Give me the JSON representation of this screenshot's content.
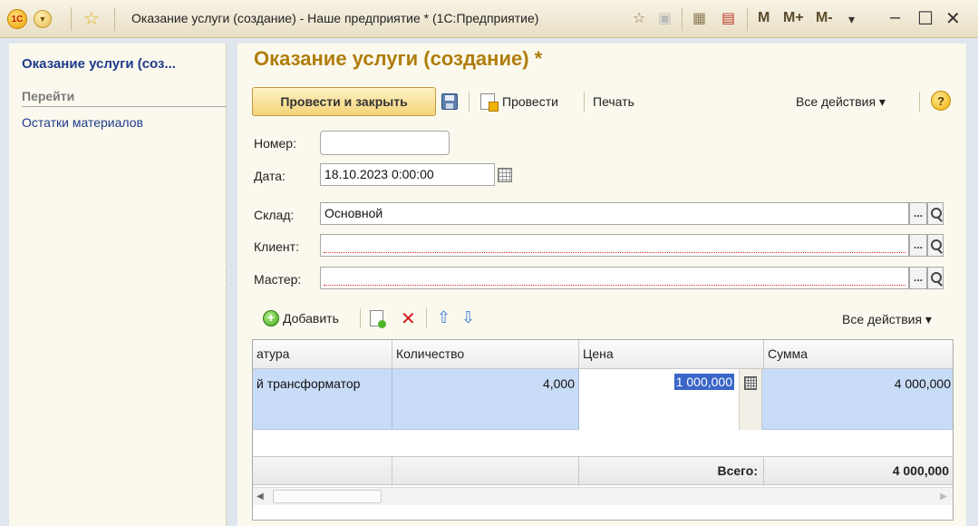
{
  "window": {
    "title": "Оказание услуги (создание) - Наше предприятие * (1С:Предприятие)",
    "logo_text": "1С",
    "controls": {
      "m": "M",
      "m_plus": "M+",
      "m_minus": "M-"
    }
  },
  "sidebar": {
    "title": "Оказание услуги (соз...",
    "section": "Перейти",
    "links": [
      "Остатки материалов"
    ]
  },
  "form": {
    "title": "Оказание услуги (создание) *",
    "toolbar": {
      "post_and_close": "Провести и закрыть",
      "post": "Провести",
      "print": "Печать",
      "all_actions": "Все действия ▾",
      "help": "?"
    },
    "fields": {
      "number": {
        "label": "Номер:",
        "value": ""
      },
      "date": {
        "label": "Дата:",
        "value": "18.10.2023  0:00:00"
      },
      "warehouse": {
        "label": "Склад:",
        "value": "Основной"
      },
      "client": {
        "label": "Клиент:",
        "value": ""
      },
      "master": {
        "label": "Мастер:",
        "value": ""
      }
    },
    "table_toolbar": {
      "add": "Добавить",
      "all_actions": "Все действия ▾"
    },
    "table": {
      "columns": [
        "атура",
        "Количество",
        "Цена",
        "Сумма"
      ],
      "rows": [
        {
          "item": "й трансформатор",
          "qty": "4,000",
          "price": "1 000,000",
          "sum": "4 000,000"
        }
      ],
      "footer": {
        "label": "Всего:",
        "total": "4 000,000"
      }
    },
    "pick_button": "..."
  },
  "colors": {
    "form_title": "#b07d0b",
    "link": "#1d3a8a",
    "selection": "#c8dcf8",
    "required_marker": "#d22222"
  }
}
